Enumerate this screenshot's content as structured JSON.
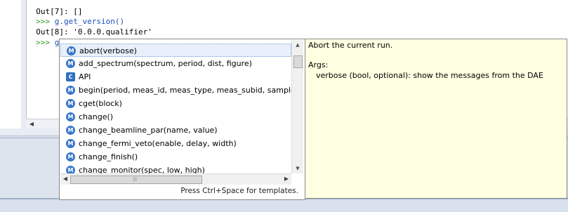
{
  "console": {
    "lines": [
      {
        "prompt": "",
        "text": "Out[7]: []",
        "kind": "out"
      },
      {
        "prompt": ">>> ",
        "text": "g.get_version()",
        "kind": "in"
      },
      {
        "prompt": "",
        "text": "Out[8]: '0.0.0.qualifier'",
        "kind": "out"
      },
      {
        "prompt": ">>> ",
        "text": "g.",
        "kind": "in"
      }
    ]
  },
  "completion": {
    "items": [
      {
        "icon": "M",
        "label": "abort(verbose)",
        "selected": true
      },
      {
        "icon": "M",
        "label": "add_spectrum(spectrum, period, dist, figure)"
      },
      {
        "icon": "C",
        "label": "API"
      },
      {
        "icon": "M",
        "label": "begin(period, meas_id, meas_type, meas_subid, sample_id"
      },
      {
        "icon": "M",
        "label": "cget(block)"
      },
      {
        "icon": "M",
        "label": "change()"
      },
      {
        "icon": "M",
        "label": "change_beamline_par(name, value)"
      },
      {
        "icon": "M",
        "label": "change_fermi_veto(enable, delay, width)"
      },
      {
        "icon": "M",
        "label": "change_finish()"
      },
      {
        "icon": "M",
        "label": "change_monitor(spec, low, high)"
      }
    ],
    "footer": "Press Ctrl+Space for templates."
  },
  "doc": {
    "summary": "Abort the current run.",
    "args_heading": "Args:",
    "args_line": "verbose (bool, optional): show the messages from the DAE"
  },
  "colors": {
    "prompt": "#2e9e2e",
    "code": "#1d4fb3",
    "doc_bg": "#ffffe1",
    "method_icon": "#3a78c9"
  }
}
